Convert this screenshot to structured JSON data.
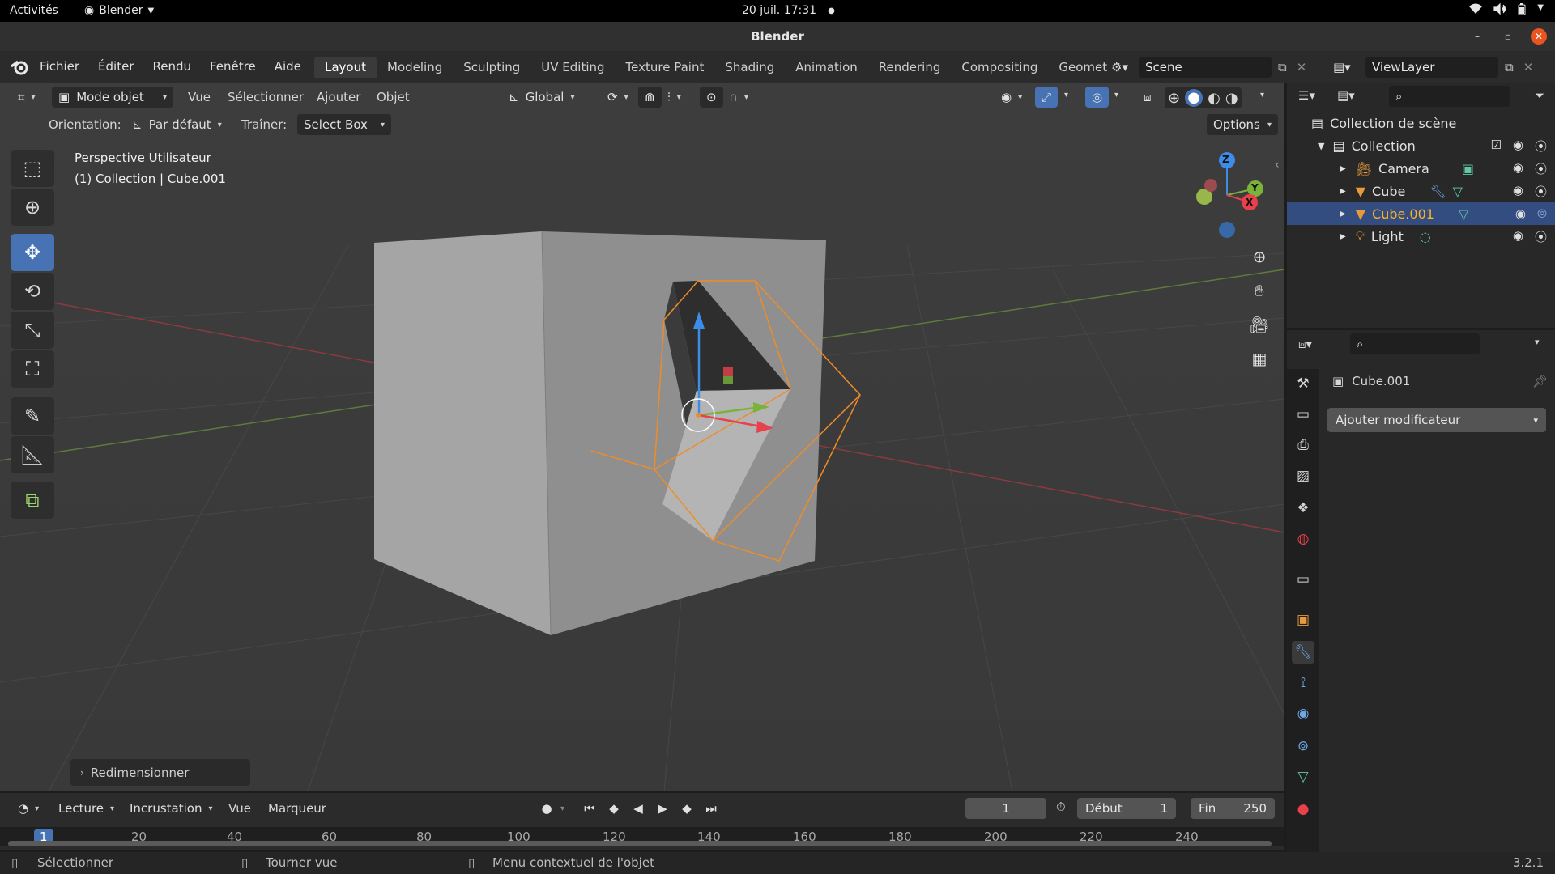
{
  "gnome": {
    "activities": "Activités",
    "app_name": "Blender",
    "clock": "20 juil.  17:31",
    "dot": "●"
  },
  "window": {
    "title": "Blender",
    "minimize": "–",
    "maximize": "▫",
    "close": "✕"
  },
  "menus": [
    "Fichier",
    "Éditer",
    "Rendu",
    "Fenêtre",
    "Aide"
  ],
  "workspace_tabs": [
    "Layout",
    "Modeling",
    "Sculpting",
    "UV Editing",
    "Texture Paint",
    "Shading",
    "Animation",
    "Rendering",
    "Compositing",
    "Geomet"
  ],
  "active_tab_index": 0,
  "scene": {
    "name": "Scene"
  },
  "view_layer": {
    "name": "ViewLayer"
  },
  "viewport_header": {
    "mode": "Mode objet",
    "view": "Vue",
    "select": "Sélectionner",
    "add": "Ajouter",
    "object": "Objet",
    "transform": "Global"
  },
  "tool_settings": {
    "orientation_label": "Orientation:",
    "orientation_value": "Par défaut",
    "drag_label": "Traîner:",
    "drag_value": "Select Box",
    "options": "Options"
  },
  "viewport": {
    "view_name": "Perspective Utilisateur",
    "context": "(1) Collection | Cube.001",
    "axis_z": "Z",
    "axis_y": "Y",
    "axis_x": "X"
  },
  "redo_panel": {
    "label": "Redimensionner"
  },
  "timeline": {
    "playback": "Lecture",
    "keying": "Incrustation",
    "view": "Vue",
    "marker": "Marqueur",
    "current_frame": "1",
    "start_label": "Début",
    "start_value": "1",
    "end_label": "Fin",
    "end_value": "250",
    "ruler": [
      "1",
      "20",
      "40",
      "60",
      "80",
      "100",
      "120",
      "140",
      "160",
      "180",
      "200",
      "220",
      "240"
    ]
  },
  "status": {
    "select": "Sélectionner",
    "rotate": "Tourner vue",
    "context_menu": "Menu contextuel de l'objet",
    "version": "3.2.1"
  },
  "outliner": {
    "scene_collection": "Collection de scène",
    "collection": "Collection",
    "items": [
      {
        "name": "Camera",
        "selected": false
      },
      {
        "name": "Cube",
        "selected": false
      },
      {
        "name": "Cube.001",
        "selected": true
      },
      {
        "name": "Light",
        "selected": false
      }
    ]
  },
  "properties": {
    "object_name": "Cube.001",
    "add_modifier": "Ajouter modificateur"
  },
  "colors": {
    "accent_blue": "#4772b3",
    "selection_orange": "#ffaf29",
    "x_axis": "#e8414b",
    "y_axis": "#7ab33a",
    "z_axis": "#3d8ce8"
  }
}
